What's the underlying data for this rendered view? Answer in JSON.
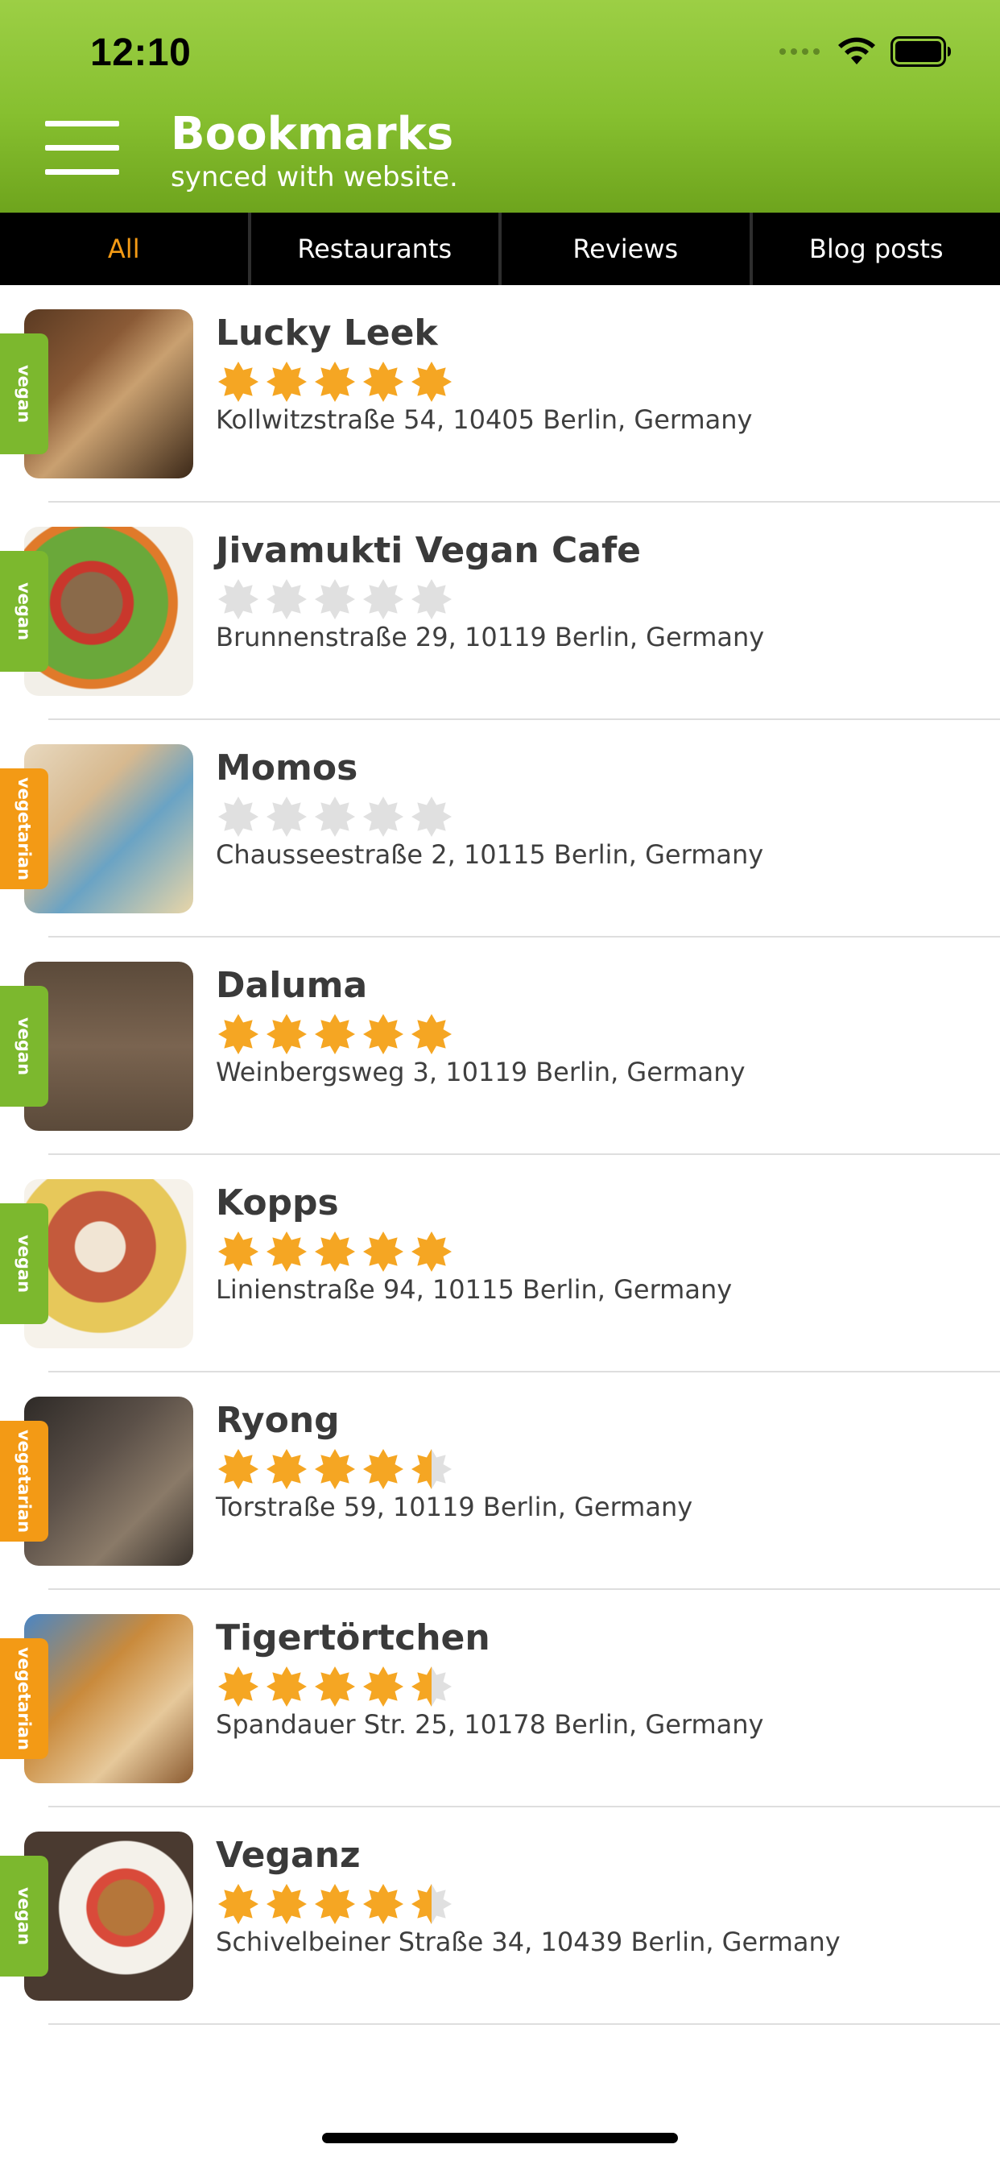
{
  "status_bar": {
    "time": "12:10"
  },
  "header": {
    "title": "Bookmarks",
    "subtitle": "synced with website."
  },
  "tabs": [
    {
      "label": "All",
      "active": true
    },
    {
      "label": "Restaurants",
      "active": false
    },
    {
      "label": "Reviews",
      "active": false
    },
    {
      "label": "Blog posts",
      "active": false
    }
  ],
  "colors": {
    "header_green": "#86bf2f",
    "tab_active": "#f39a15",
    "vegan_tag": "#7cb82e",
    "vegetarian_tag": "#f39a15",
    "star": "#f5a623",
    "star_empty": "#e0e0e0"
  },
  "items": [
    {
      "name": "Lucky Leek",
      "rating": 5,
      "address": "Kollwitzstraße 54, 10405 Berlin, Germany",
      "diet": "vegan",
      "photo": "restaurant-interior-photo"
    },
    {
      "name": "Jivamukti Vegan Cafe",
      "rating": 0,
      "address": "Brunnenstraße 29, 10119 Berlin, Germany",
      "diet": "vegan",
      "photo": "salad-plate-photo"
    },
    {
      "name": "Momos",
      "rating": 0,
      "address": "Chausseestraße 2, 10115 Berlin, Germany",
      "diet": "vegetarian",
      "photo": "dumplings-photo"
    },
    {
      "name": "Daluma",
      "rating": 5,
      "address": "Weinbergsweg 3, 10119 Berlin, Germany",
      "diet": "vegan",
      "photo": "bowls-on-table-photo"
    },
    {
      "name": "Kopps",
      "rating": 5,
      "address": "Linienstraße 94, 10115 Berlin, Germany",
      "diet": "vegan",
      "photo": "plated-dish-photo"
    },
    {
      "name": "Ryong",
      "rating": 4.5,
      "address": "Torstraße 59, 10119 Berlin, Germany",
      "diet": "vegetarian",
      "photo": "dining-room-photo"
    },
    {
      "name": "Tigertörtchen",
      "rating": 4.5,
      "address": "Spandauer Str. 25, 10178 Berlin, Germany",
      "diet": "vegetarian",
      "photo": "cupcakes-photo"
    },
    {
      "name": "Veganz",
      "rating": 4.5,
      "address": "Schivelbeiner Straße 34, 10439 Berlin, Germany",
      "diet": "vegan",
      "photo": "bagel-sandwich-photo"
    }
  ]
}
